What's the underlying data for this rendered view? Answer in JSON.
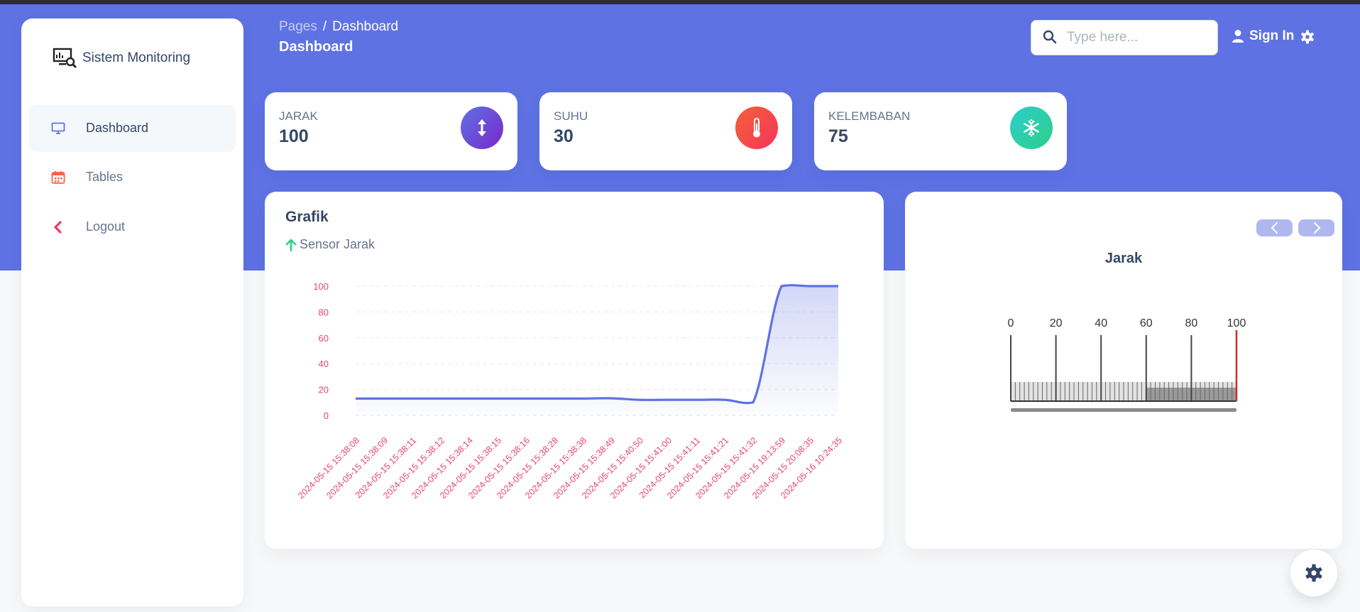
{
  "sidebar": {
    "brand": "Sistem Monitoring",
    "items": [
      {
        "label": "Dashboard",
        "icon": "monitor-icon"
      },
      {
        "label": "Tables",
        "icon": "calendar-icon"
      },
      {
        "label": "Logout",
        "icon": "chevron-left-icon"
      }
    ]
  },
  "header": {
    "breadcrumb_root": "Pages",
    "breadcrumb_current": "Dashboard",
    "title": "Dashboard",
    "search_placeholder": "Type here...",
    "sign_in": "Sign In"
  },
  "stats": [
    {
      "label": "JARAK",
      "value": "100",
      "icon": "arrows-vertical-icon",
      "color": "#7c5ce6"
    },
    {
      "label": "SUHU",
      "value": "30",
      "icon": "thermometer-icon",
      "color": "#f5365c"
    },
    {
      "label": "KELEMBABAN",
      "value": "75",
      "icon": "snowflake-icon",
      "color": "#2dce89"
    }
  ],
  "chart": {
    "title": "Grafik",
    "subtitle": "Sensor Jarak"
  },
  "chart_data": {
    "type": "area",
    "x": [
      "2024-05-15 15:38:08",
      "2024-05-15 15:38:09",
      "2024-05-15 15:38:11",
      "2024-05-15 15:38:12",
      "2024-05-15 15:38:14",
      "2024-05-15 15:38:15",
      "2024-05-15 15:38:16",
      "2024-05-15 15:38:28",
      "2024-05-15 15:38:38",
      "2024-05-15 15:38:49",
      "2024-05-15 15:40:50",
      "2024-05-15 15:41:00",
      "2024-05-15 15:41:11",
      "2024-05-15 15:41:21",
      "2024-05-15 15:41:32",
      "2024-05-15 19:13:59",
      "2024-05-15 20:08:35",
      "2024-05-16 10:24:35"
    ],
    "series": [
      {
        "values": [
          13,
          13,
          13,
          13,
          13,
          13,
          13,
          13,
          13,
          13.2,
          12,
          12,
          12,
          12,
          10,
          100,
          100,
          100
        ]
      }
    ],
    "yticks": [
      0,
      20,
      40,
      60,
      80,
      100
    ],
    "ylim": [
      0,
      100
    ],
    "grid": true,
    "colors": {
      "line": "#5e72e4",
      "ticks": "#e8466f"
    }
  },
  "gauge": {
    "title": "Jarak",
    "value": 100,
    "min": 0,
    "max": 100,
    "ticks": [
      "0",
      "20",
      "40",
      "60",
      "80",
      "100"
    ],
    "indicator_color": "#cc2c2c"
  }
}
